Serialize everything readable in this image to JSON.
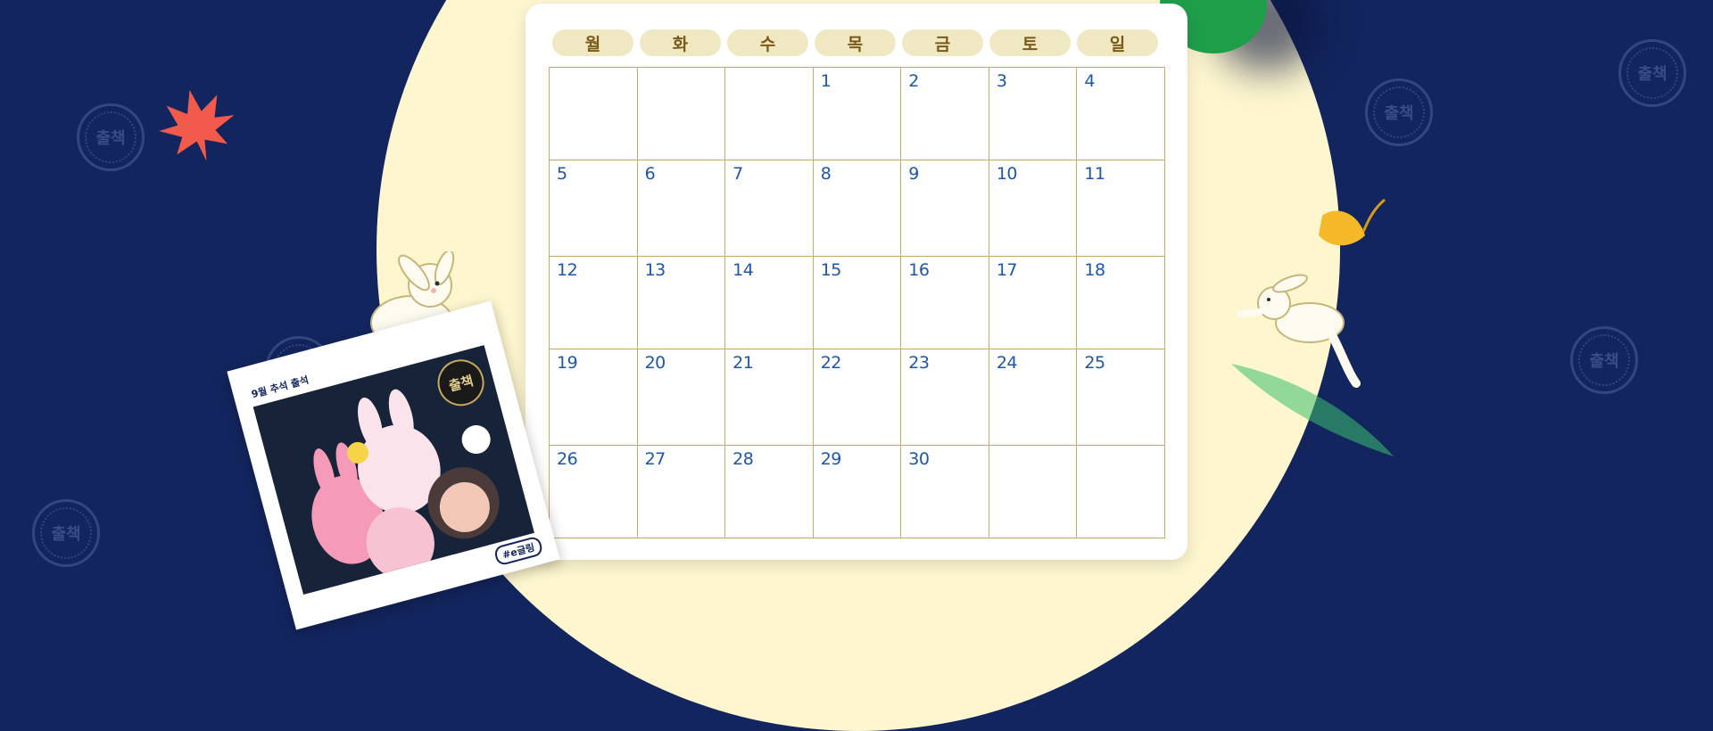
{
  "calendar": {
    "weekdays": [
      "월",
      "화",
      "수",
      "목",
      "금",
      "토",
      "일"
    ],
    "weeks": [
      [
        "",
        "",
        "",
        "1",
        "2",
        "3",
        "4"
      ],
      [
        "5",
        "6",
        "7",
        "8",
        "9",
        "10",
        "11"
      ],
      [
        "12",
        "13",
        "14",
        "15",
        "16",
        "17",
        "18"
      ],
      [
        "19",
        "20",
        "21",
        "22",
        "23",
        "24",
        "25"
      ],
      [
        "26",
        "27",
        "28",
        "29",
        "30",
        "",
        ""
      ]
    ]
  },
  "photo_card": {
    "title": "9월 추석 출석",
    "badge": "출책",
    "tag": "#e글링"
  },
  "decor": {
    "stamp_text": "출책",
    "icons": [
      "maple-leaf-icon",
      "ginkgo-leaf-icon",
      "rabbit-icon",
      "leaping-rabbit-icon",
      "green-cap-icon"
    ]
  },
  "colors": {
    "background": "#13255e",
    "moon": "#fdf6cf",
    "day_pill": "#f0e8c3",
    "date_text": "#1d57a8",
    "grid_line": "#c9ac63"
  }
}
